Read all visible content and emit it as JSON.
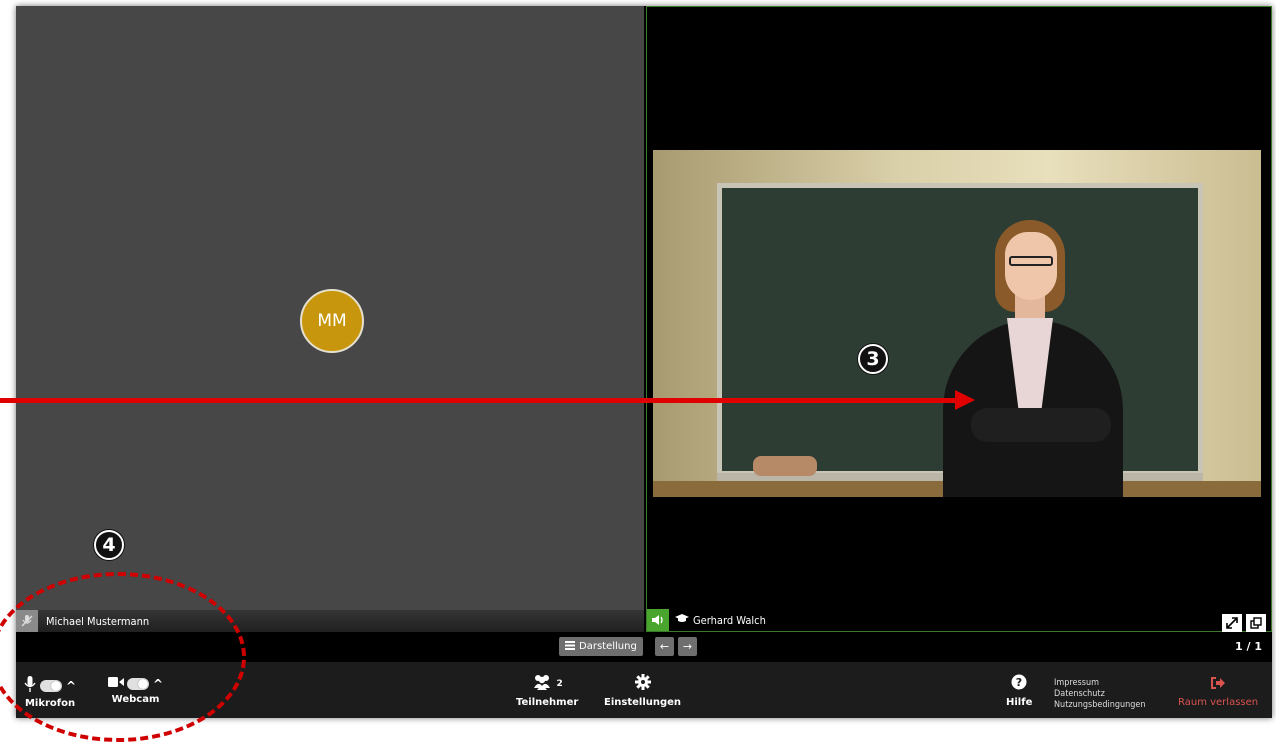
{
  "left_tile": {
    "avatar_initials": "MM",
    "participant_name": "Michael Mustermann",
    "icons": {
      "mic": "microphone-muted-icon"
    }
  },
  "right_tile": {
    "participant_name": "Gerhard Walch",
    "icons": {
      "speaker": "speaker-icon",
      "presenter": "graduation-cap-icon",
      "fullscreen": "fullscreen-icon",
      "popout": "popout-icon"
    }
  },
  "layout_bar": {
    "darstellung_label": "Darstellung",
    "page_indicator": "1 / 1"
  },
  "toolbar": {
    "microphone_label": "Mikrofon",
    "webcam_label": "Webcam",
    "participants_label": "Teilnehmer",
    "participants_count": "2",
    "settings_label": "Einstellungen",
    "help_label": "Hilfe",
    "legal_links": [
      "Impressum",
      "Datenschutz",
      "Nutzungsbedingungen"
    ],
    "leave_label": "Raum verlassen"
  },
  "annotations": {
    "three": "3",
    "four": "4"
  },
  "colors": {
    "accent_green": "#4aa52e",
    "avatar_gold": "#c8960c",
    "leave_red": "#d9534f",
    "annotation_red": "#e00000"
  }
}
